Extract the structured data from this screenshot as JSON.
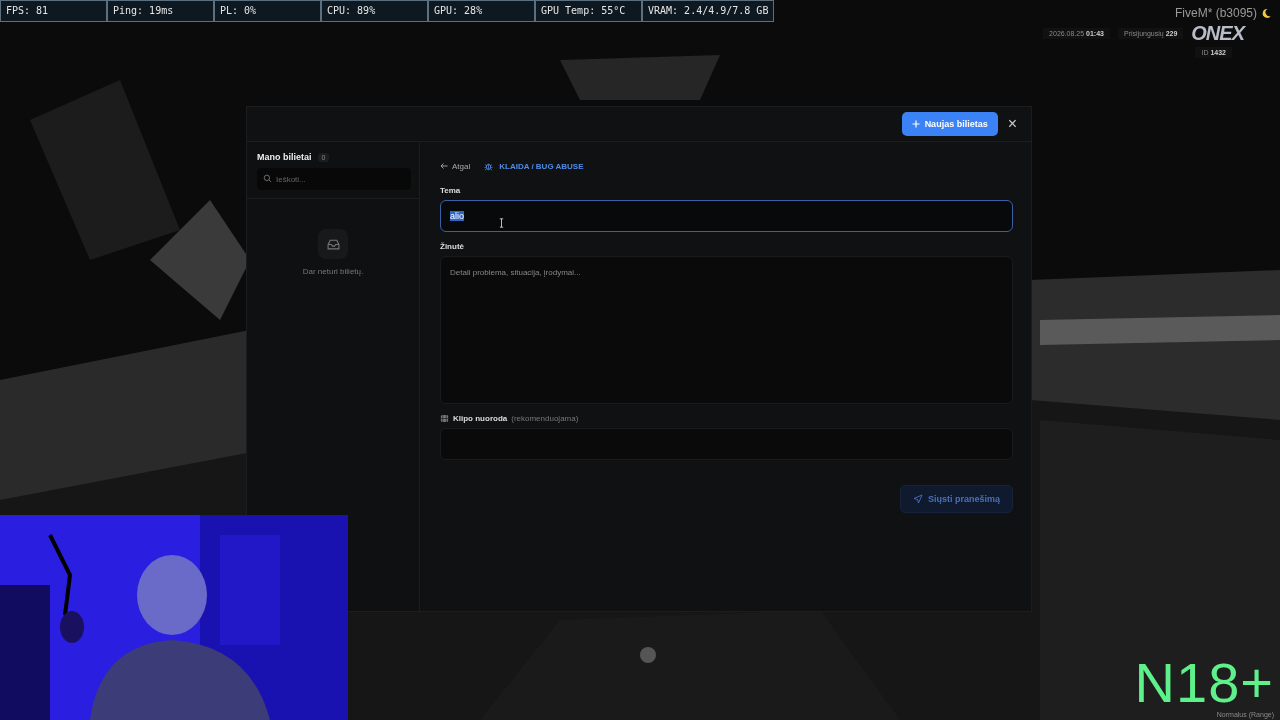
{
  "stats_bar": [
    "FPS: 81",
    "Ping: 19ms",
    "PL: 0%",
    "CPU: 89%",
    "GPU: 28%",
    "GPU Temp: 55°C",
    "VRAM: 2.4/4.9/7.8 GB"
  ],
  "hud": {
    "app_title": "FiveM* (b3095)",
    "date": "2026.08.25",
    "time": "01:43",
    "online_label": "Prisijungusių",
    "online_count": "229",
    "logo": "ONEX",
    "id_label": "ID",
    "id_value": "1432"
  },
  "modal": {
    "new_button": "Naujas bilietas",
    "close": "×",
    "sidebar": {
      "title": "Mano bilietai",
      "count": "0",
      "search_placeholder": "Ieškoti...",
      "empty_text": "Dar neturi bilietų."
    },
    "breadcrumb": {
      "back": "Atgal",
      "category": "KLAIDA / BUG ABUSE"
    },
    "fields": [
      {
        "kind": "input",
        "label": "Tema",
        "value": "alio",
        "value_selected": true,
        "focused": true
      },
      {
        "kind": "textarea",
        "label": "Žinutė",
        "placeholder": "Detali problema, situacija, įrodymai...",
        "focused": false
      },
      {
        "kind": "input",
        "label": "Klipo nuoroda",
        "hint": "(rekomenduojama)",
        "focused": false
      }
    ],
    "submit": {
      "label": "Siųsti pranešimą",
      "disabled": true
    }
  },
  "rating": {
    "badge": "N18+",
    "mode": "Normalus (Range)"
  }
}
